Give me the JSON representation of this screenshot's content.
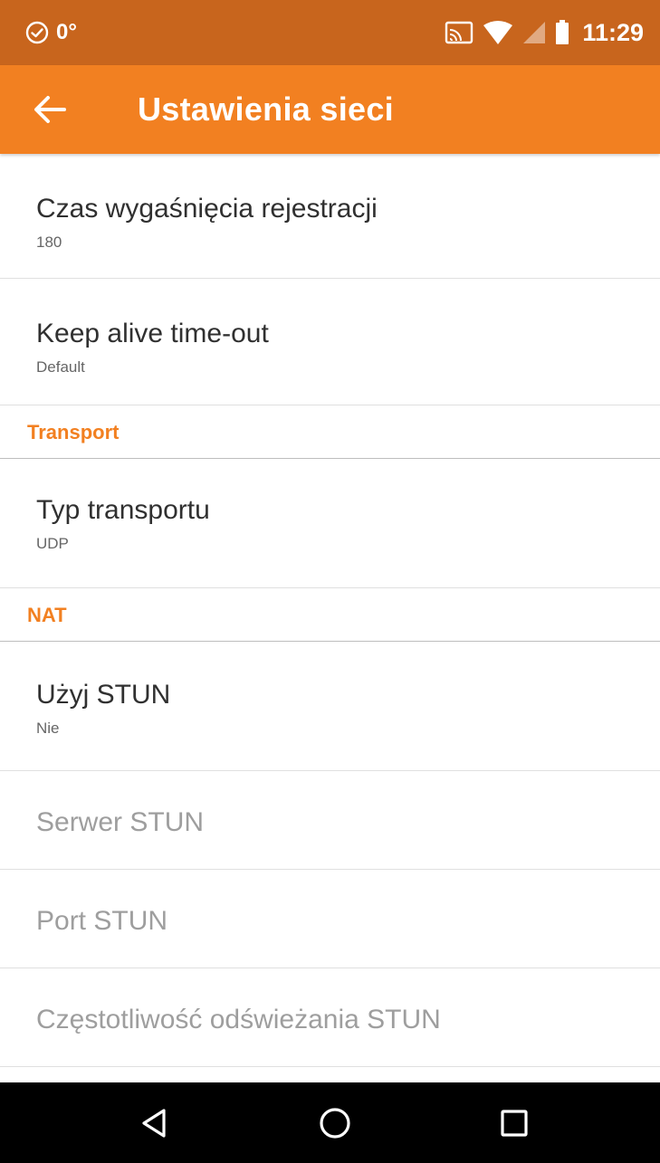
{
  "status_bar": {
    "notification_icon": "check-circle-icon",
    "temperature": "0°",
    "time": "11:29",
    "icons": [
      "cast-icon",
      "wifi-icon",
      "signal-icon",
      "battery-icon"
    ]
  },
  "app_bar": {
    "back_icon": "arrow-left-icon",
    "title": "Ustawienia sieci"
  },
  "settings": {
    "registration_expiry": {
      "title": "Czas wygaśnięcia rejestracji",
      "summary": "180"
    },
    "keep_alive": {
      "title": "Keep alive time-out",
      "summary": "Default"
    },
    "transport_category": "Transport",
    "transport_type": {
      "title": "Typ transportu",
      "summary": "UDP"
    },
    "nat_category": "NAT",
    "use_stun": {
      "title": "Użyj STUN",
      "summary": "Nie"
    },
    "stun_server": {
      "title": "Serwer STUN"
    },
    "stun_port": {
      "title": "Port STUN"
    },
    "stun_refresh": {
      "title": "Częstotliwość odświeżania STUN"
    }
  },
  "colors": {
    "status_bar": "#c8651d",
    "app_bar": "#f28021",
    "category_text": "#f28021",
    "nav_bar": "#000000"
  },
  "nav_bar": {
    "icons": [
      "back-triangle-icon",
      "home-circle-icon",
      "recents-square-icon"
    ]
  }
}
